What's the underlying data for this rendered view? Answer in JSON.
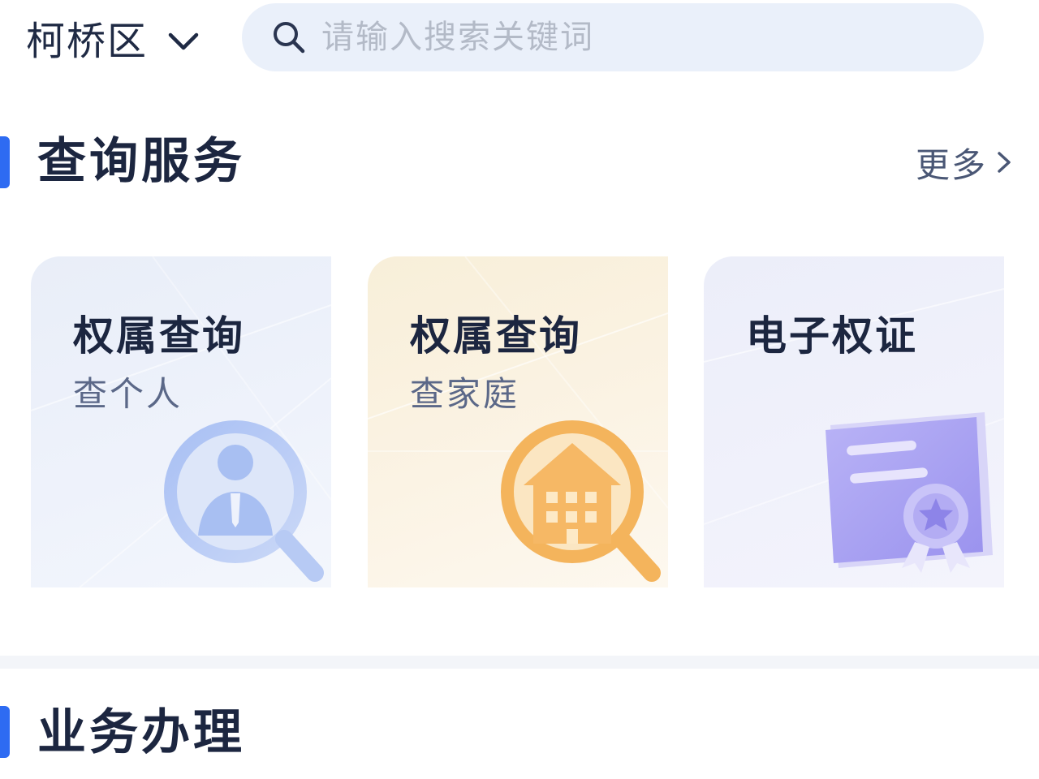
{
  "header": {
    "district": "柯桥区",
    "search_placeholder": "请输入搜索关键词"
  },
  "query_section": {
    "title": "查询服务",
    "more_label": "更多",
    "cards": [
      {
        "title": "权属查询",
        "subtitle": "查个人"
      },
      {
        "title": "权属查询",
        "subtitle": "查家庭"
      },
      {
        "title": "电子权证",
        "subtitle": ""
      }
    ]
  },
  "business_section": {
    "title": "业务办理"
  },
  "icons": {
    "district_dropdown": "chevron-down-icon",
    "search": "search-icon",
    "more": "chevron-right-icon",
    "card_1": "person-search-icon",
    "card_2": "house-search-icon",
    "card_3": "certificate-icon"
  },
  "colors": {
    "accent": "#2e6bf2",
    "title_text": "#1c2640",
    "search_bg": "#eaf0fa"
  }
}
